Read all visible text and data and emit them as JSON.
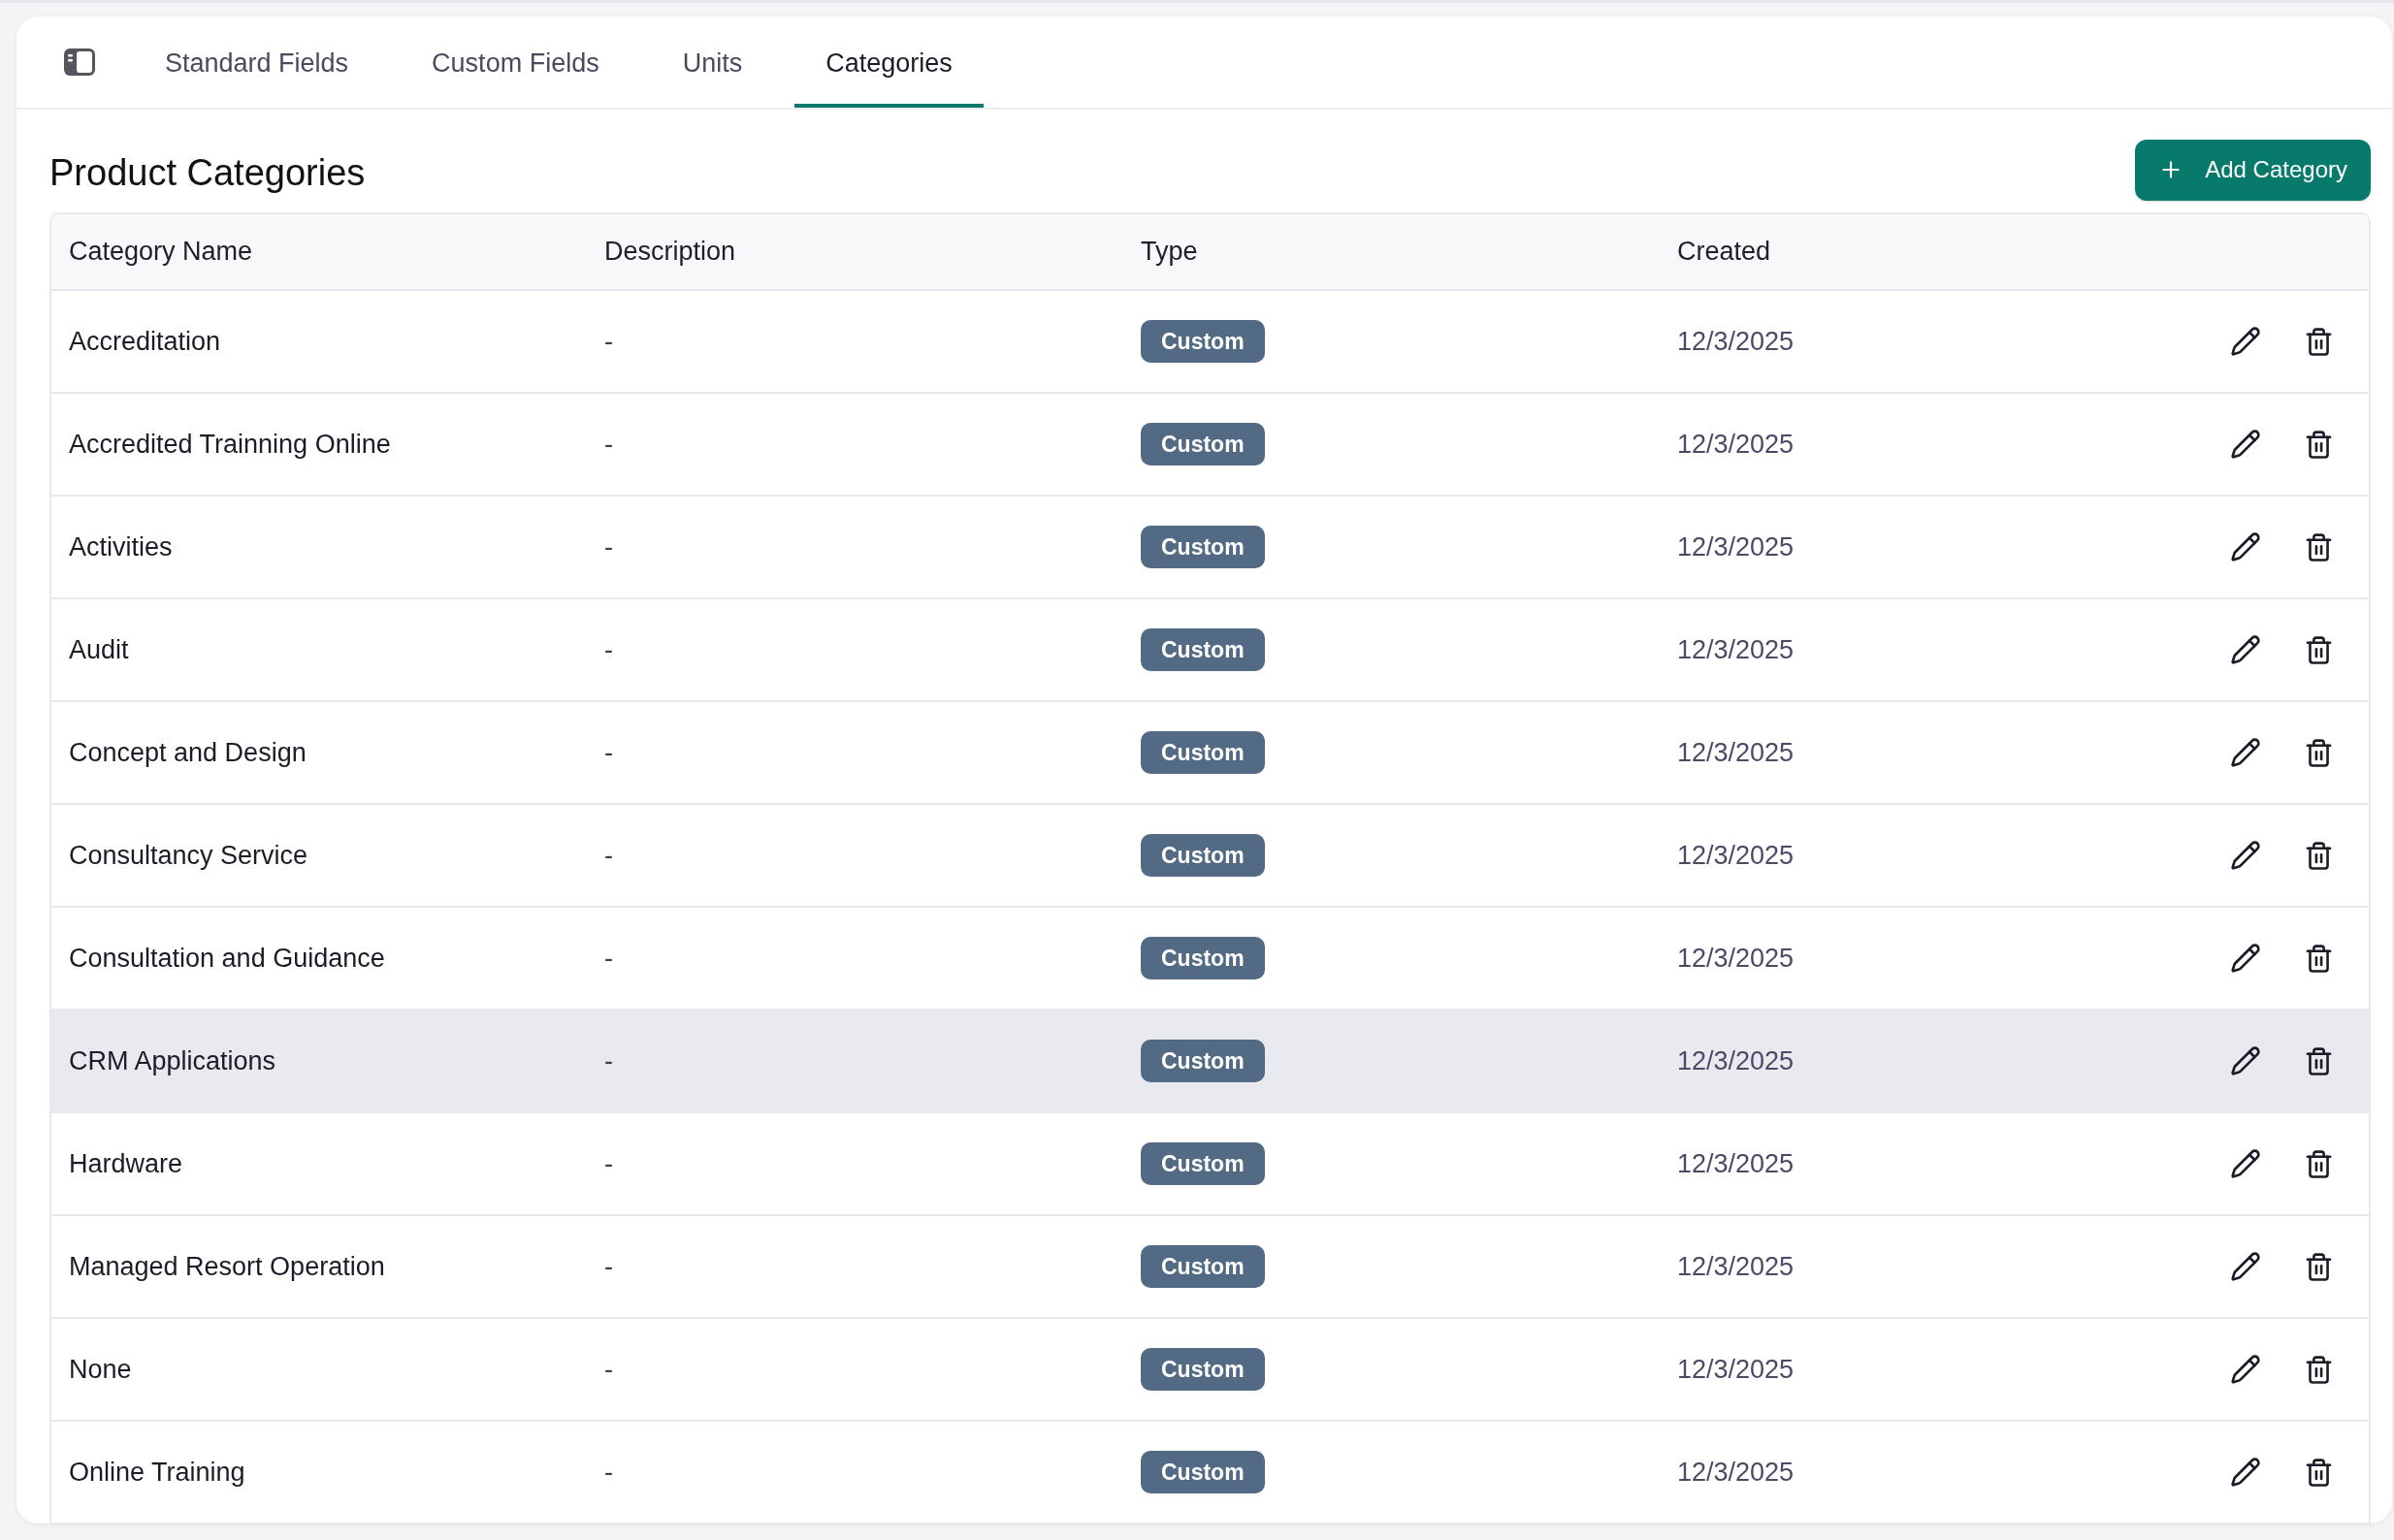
{
  "tabs": [
    {
      "label": "Standard Fields",
      "selected": false
    },
    {
      "label": "Custom Fields",
      "selected": false
    },
    {
      "label": "Units",
      "selected": false
    },
    {
      "label": "Categories",
      "selected": true
    }
  ],
  "header": {
    "title": "Product Categories",
    "add_button": "Add Category"
  },
  "table": {
    "columns": [
      "Category Name",
      "Description",
      "Type",
      "Created"
    ],
    "rows": [
      {
        "name": "Accreditation",
        "description": "-",
        "type": "Custom",
        "created": "12/3/2025",
        "highlighted": false
      },
      {
        "name": "Accredited Trainning Online",
        "description": "-",
        "type": "Custom",
        "created": "12/3/2025",
        "highlighted": false
      },
      {
        "name": "Activities",
        "description": "-",
        "type": "Custom",
        "created": "12/3/2025",
        "highlighted": false
      },
      {
        "name": "Audit",
        "description": "-",
        "type": "Custom",
        "created": "12/3/2025",
        "highlighted": false
      },
      {
        "name": "Concept and Design",
        "description": "-",
        "type": "Custom",
        "created": "12/3/2025",
        "highlighted": false
      },
      {
        "name": "Consultancy Service",
        "description": "-",
        "type": "Custom",
        "created": "12/3/2025",
        "highlighted": false
      },
      {
        "name": "Consultation and Guidance",
        "description": "-",
        "type": "Custom",
        "created": "12/3/2025",
        "highlighted": false
      },
      {
        "name": "CRM Applications",
        "description": "-",
        "type": "Custom",
        "created": "12/3/2025",
        "highlighted": true
      },
      {
        "name": "Hardware",
        "description": "-",
        "type": "Custom",
        "created": "12/3/2025",
        "highlighted": false
      },
      {
        "name": "Managed Resort Operation",
        "description": "-",
        "type": "Custom",
        "created": "12/3/2025",
        "highlighted": false
      },
      {
        "name": "None",
        "description": "-",
        "type": "Custom",
        "created": "12/3/2025",
        "highlighted": false
      },
      {
        "name": "Online Training",
        "description": "-",
        "type": "Custom",
        "created": "12/3/2025",
        "highlighted": false
      }
    ]
  }
}
